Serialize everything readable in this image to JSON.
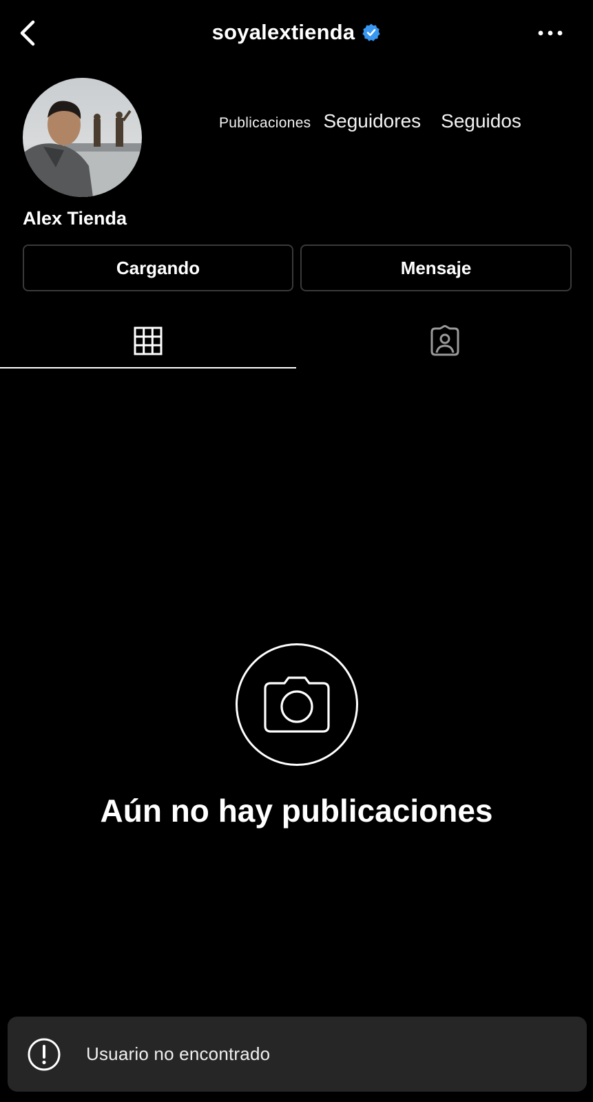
{
  "header": {
    "username": "soyalextienda",
    "verified": true,
    "back_icon": "chevron-left-icon",
    "more_icon": "more-horizontal-icon"
  },
  "profile": {
    "display_name": "Alex Tienda",
    "avatar_icon": "profile-photo",
    "stats": {
      "posts_label": "Publicaciones",
      "followers_label": "Seguidores",
      "following_label": "Seguidos"
    }
  },
  "actions": {
    "primary_label": "Cargando",
    "message_label": "Mensaje"
  },
  "tabs": [
    {
      "icon": "grid-icon",
      "active": true
    },
    {
      "icon": "tagged-icon",
      "active": false
    }
  ],
  "empty_state": {
    "icon": "camera-icon",
    "title": "Aún no hay publicaciones"
  },
  "toast": {
    "icon": "alert-circle-icon",
    "message": "Usuario no encontrado"
  },
  "colors": {
    "background": "#000000",
    "toast_bg": "#262626",
    "button_border": "#3a3a3a",
    "verified_blue": "#3897f0"
  }
}
